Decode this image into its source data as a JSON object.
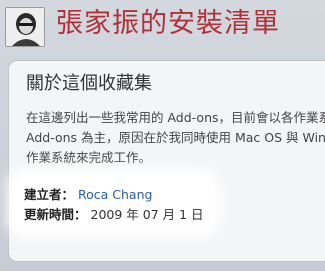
{
  "header": {
    "avatar_icon": "user-avatar-icon",
    "title": "張家振的安裝清單"
  },
  "collection": {
    "heading": "關於這個收藏集",
    "description_lines": [
      "在這邊列出一些我常用的 Add-ons，目前會以各作業系",
      "Add-ons 為主，原因在於我同時使用 Mac OS 與 Wind",
      "作業系統來完成工作。"
    ],
    "creator_label": "建立者：",
    "creator_name": "Roca Chang",
    "updated_label": "更新時間：",
    "updated_value": "2009 年 07 月 1 日"
  },
  "colors": {
    "title": "#b1313a",
    "link": "#2b5fad",
    "background": "#c9ced6"
  }
}
